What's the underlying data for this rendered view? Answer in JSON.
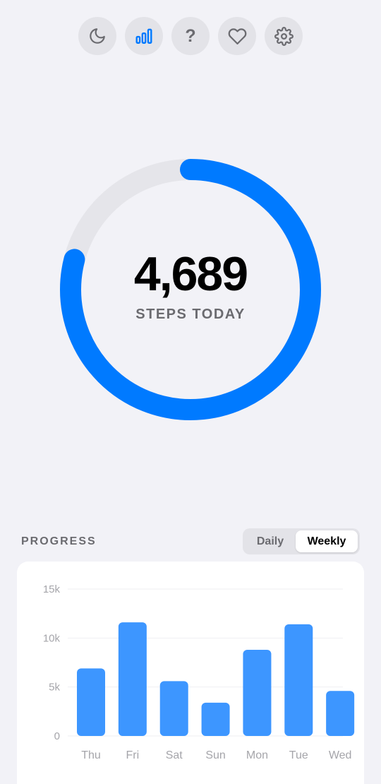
{
  "toolbar": {
    "buttons": [
      {
        "name": "moon-icon",
        "active": false
      },
      {
        "name": "bar-chart-icon",
        "active": true
      },
      {
        "name": "question-icon",
        "active": false,
        "glyph": "?"
      },
      {
        "name": "heart-icon",
        "active": false
      },
      {
        "name": "gear-icon",
        "active": false
      }
    ]
  },
  "ring": {
    "steps": "4,689",
    "label": "STEPS TODAY",
    "progress_fraction": 0.79
  },
  "progress": {
    "title": "PROGRESS",
    "toggle": {
      "options": [
        "Daily",
        "Weekly"
      ],
      "selected": "Weekly"
    }
  },
  "colors": {
    "accent": "#007aff",
    "bar": "#3d96ff",
    "track": "#e5e5ea",
    "background": "#f2f2f7"
  },
  "chart_data": {
    "type": "bar",
    "categories": [
      "Thu",
      "Fri",
      "Sat",
      "Sun",
      "Mon",
      "Tue",
      "Wed"
    ],
    "values": [
      6900,
      11600,
      5600,
      3400,
      8800,
      11400,
      4600
    ],
    "yticks": [
      "0",
      "5k",
      "10k",
      "15k"
    ],
    "ytick_values": [
      0,
      5000,
      10000,
      15000
    ],
    "ylim": [
      0,
      15000
    ],
    "grid": true
  }
}
